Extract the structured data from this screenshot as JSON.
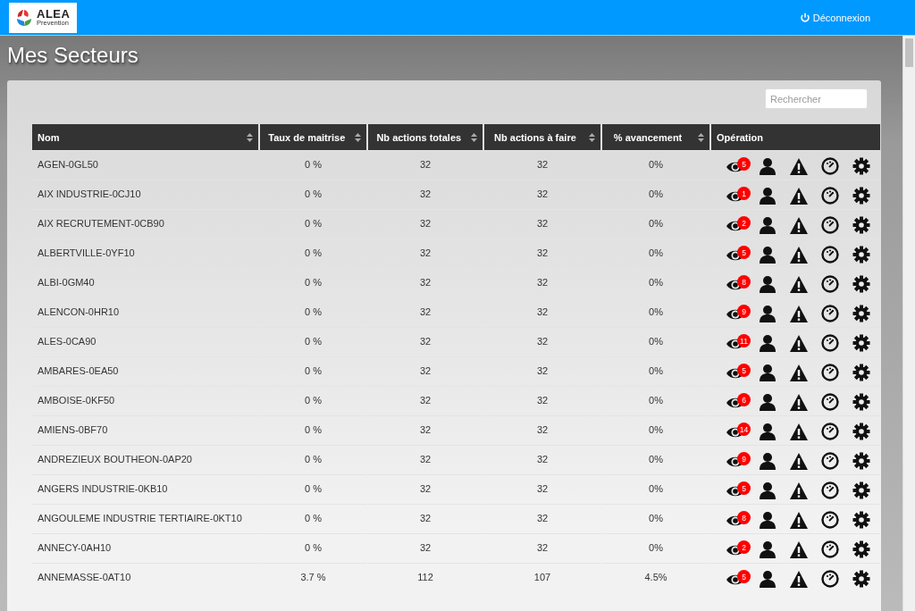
{
  "header": {
    "logo": {
      "name": "ALEA",
      "subtitle": "Prevention"
    },
    "logout": "Déconnexion"
  },
  "page_title": "Mes Secteurs",
  "search": {
    "placeholder": "Rechercher"
  },
  "table": {
    "columns": [
      {
        "label": "Nom",
        "sortable": true
      },
      {
        "label": "Taux de maitrise",
        "sortable": true
      },
      {
        "label": "Nb actions totales",
        "sortable": true
      },
      {
        "label": "Nb actions à faire",
        "sortable": true
      },
      {
        "label": "% avancement",
        "sortable": true
      },
      {
        "label": "Opération",
        "sortable": false
      }
    ],
    "rows": [
      {
        "name": "AGEN-0GL50",
        "mastery": "0 %",
        "total": "32",
        "todo": "32",
        "progress": "0%",
        "alerts": "5"
      },
      {
        "name": "AIX INDUSTRIE-0CJ10",
        "mastery": "0 %",
        "total": "32",
        "todo": "32",
        "progress": "0%",
        "alerts": "1"
      },
      {
        "name": "AIX RECRUTEMENT-0CB90",
        "mastery": "0 %",
        "total": "32",
        "todo": "32",
        "progress": "0%",
        "alerts": "2"
      },
      {
        "name": "ALBERTVILLE-0YF10",
        "mastery": "0 %",
        "total": "32",
        "todo": "32",
        "progress": "0%",
        "alerts": "5"
      },
      {
        "name": "ALBI-0GM40",
        "mastery": "0 %",
        "total": "32",
        "todo": "32",
        "progress": "0%",
        "alerts": "8"
      },
      {
        "name": "ALENCON-0HR10",
        "mastery": "0 %",
        "total": "32",
        "todo": "32",
        "progress": "0%",
        "alerts": "9"
      },
      {
        "name": "ALES-0CA90",
        "mastery": "0 %",
        "total": "32",
        "todo": "32",
        "progress": "0%",
        "alerts": "11"
      },
      {
        "name": "AMBARES-0EA50",
        "mastery": "0 %",
        "total": "32",
        "todo": "32",
        "progress": "0%",
        "alerts": "5"
      },
      {
        "name": "AMBOISE-0KF50",
        "mastery": "0 %",
        "total": "32",
        "todo": "32",
        "progress": "0%",
        "alerts": "6"
      },
      {
        "name": "AMIENS-0BF70",
        "mastery": "0 %",
        "total": "32",
        "todo": "32",
        "progress": "0%",
        "alerts": "14"
      },
      {
        "name": "ANDREZIEUX BOUTHEON-0AP20",
        "mastery": "0 %",
        "total": "32",
        "todo": "32",
        "progress": "0%",
        "alerts": "9"
      },
      {
        "name": "ANGERS INDUSTRIE-0KB10",
        "mastery": "0 %",
        "total": "32",
        "todo": "32",
        "progress": "0%",
        "alerts": "5"
      },
      {
        "name": "ANGOULEME INDUSTRIE TERTIAIRE-0KT10",
        "mastery": "0 %",
        "total": "32",
        "todo": "32",
        "progress": "0%",
        "alerts": "8"
      },
      {
        "name": "ANNECY-0AH10",
        "mastery": "0 %",
        "total": "32",
        "todo": "32",
        "progress": "0%",
        "alerts": "2"
      },
      {
        "name": "ANNEMASSE-0AT10",
        "mastery": "3.7 %",
        "total": "112",
        "todo": "107",
        "progress": "4.5%",
        "alerts": "5"
      }
    ]
  }
}
